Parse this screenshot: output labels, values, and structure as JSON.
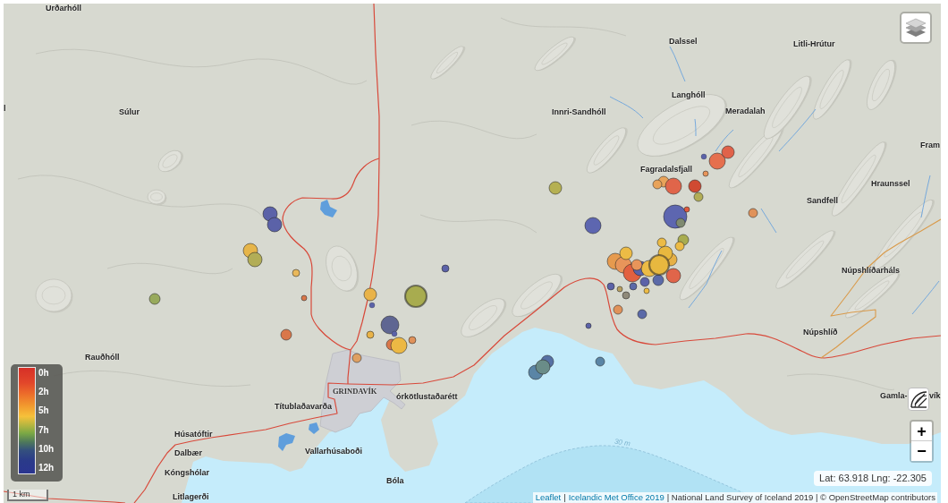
{
  "map": {
    "place_labels": [
      {
        "text": "Urðarhóll",
        "kind": "place"
      },
      {
        "text": "Dalssel",
        "kind": "place"
      },
      {
        "text": "Litli-Hrútur",
        "kind": "place"
      },
      {
        "text": "Langhóll",
        "kind": "place"
      },
      {
        "text": "l",
        "kind": "place"
      },
      {
        "text": "Súlur",
        "kind": "place"
      },
      {
        "text": "Innri-Sandhóll",
        "kind": "place"
      },
      {
        "text": "Meradalah",
        "kind": "place"
      },
      {
        "text": "Fram",
        "kind": "place"
      },
      {
        "text": "Fagradalsfjall",
        "kind": "place"
      },
      {
        "text": "Hraunssel",
        "kind": "place"
      },
      {
        "text": "Sandfell",
        "kind": "place"
      },
      {
        "text": "Núpshlíðarháls",
        "kind": "place"
      },
      {
        "text": "Núpshlíð",
        "kind": "place"
      },
      {
        "text": "Rauðhóll",
        "kind": "place"
      },
      {
        "text": "GRINDAVÍK",
        "kind": "town"
      },
      {
        "text": "órkötlustaðarétt",
        "kind": "place"
      },
      {
        "text": "Gamla-",
        "kind": "place"
      },
      {
        "text": "vík",
        "kind": "place"
      },
      {
        "text": "Títublaðavarða",
        "kind": "place"
      },
      {
        "text": "Húsatóftir",
        "kind": "place"
      },
      {
        "text": "30 m",
        "kind": "depth"
      },
      {
        "text": "Dalbær",
        "kind": "place"
      },
      {
        "text": "Vallarhúsaboði",
        "kind": "place"
      },
      {
        "text": "Kóngshólar",
        "kind": "place"
      },
      {
        "text": "Bóla",
        "kind": "place"
      },
      {
        "text": "Litlagerði",
        "kind": "place"
      }
    ],
    "earthquakes": [
      {
        "color": "#5b62a8"
      },
      {
        "color": "#5b62a8"
      },
      {
        "color": "#e6b549"
      },
      {
        "color": "#b2ad56"
      },
      {
        "color": "#e9b85a"
      },
      {
        "color": "#98aa5c"
      },
      {
        "color": "#d9774a"
      },
      {
        "color": "#d9774a"
      },
      {
        "color": "#e9b348"
      },
      {
        "color": "#5b62a8"
      },
      {
        "color": "#a8ac4f"
      },
      {
        "color": "#5b62a8"
      },
      {
        "color": "#5f6692"
      },
      {
        "color": "#5b62a8"
      },
      {
        "color": "#e9b348"
      },
      {
        "color": "#d9774a"
      },
      {
        "color": "#ecb844"
      },
      {
        "color": "#e0925a"
      },
      {
        "color": "#dfa062"
      },
      {
        "color": "#b5b052"
      },
      {
        "color": "#5d66b0"
      },
      {
        "color": "#e0925a"
      },
      {
        "color": "#5670a4"
      },
      {
        "color": "#5a85a6"
      },
      {
        "color": "#6a8c88"
      },
      {
        "color": "#5a85a6"
      },
      {
        "color": "#5b62a8"
      },
      {
        "color": "#e0925a"
      },
      {
        "color": "#5b6aa8"
      },
      {
        "color": "#5b62a8"
      },
      {
        "color": "#b8a060"
      },
      {
        "color": "#5d66b0"
      },
      {
        "color": "#7f8a70"
      },
      {
        "color": "#e05a3e"
      },
      {
        "color": "#e8a35a"
      },
      {
        "color": "#e8a35a"
      },
      {
        "color": "#e0654a"
      },
      {
        "color": "#d04a32"
      },
      {
        "color": "#b2ad56"
      },
      {
        "color": "#e56f4e"
      },
      {
        "color": "#e0624a"
      },
      {
        "color": "#e8955a"
      },
      {
        "color": "#5b62a8"
      },
      {
        "color": "#a8ac4f"
      },
      {
        "color": "#ecbb45"
      },
      {
        "color": "#e6b045"
      },
      {
        "color": "#e69a4e"
      },
      {
        "color": "#e8955a"
      },
      {
        "color": "#ecbb45"
      },
      {
        "color": "#e2603f"
      },
      {
        "color": "#5b62a8"
      },
      {
        "color": "#ecbb45"
      },
      {
        "color": "#e8b83f"
      },
      {
        "color": "#ecbb45"
      },
      {
        "color": "#5b6aa8"
      },
      {
        "color": "#5b62a8"
      },
      {
        "color": "#5b6aa8"
      },
      {
        "color": "#8f8a7a"
      },
      {
        "color": "#ecbb45"
      },
      {
        "color": "#e8b83f"
      },
      {
        "color": "#e0654a"
      },
      {
        "color": "#e8955a"
      }
    ]
  },
  "controls": {
    "zoom_in": "+",
    "zoom_out": "−"
  },
  "legend": {
    "ticks": [
      "0h",
      "2h",
      "5h",
      "7h",
      "10h",
      "12h"
    ]
  },
  "scale": "1 km",
  "coordinates": "Lat: 63.918 Lng: -22.305",
  "attribution": [
    {
      "text": "Leaflet",
      "kind": "link"
    },
    {
      "text": "|",
      "kind": "text"
    },
    {
      "text": "Icelandic Met Office 2019",
      "kind": "link"
    },
    {
      "text": "| National Land Survey of Iceland 2019 | © OpenStreetMap contributors",
      "kind": "text"
    }
  ]
}
